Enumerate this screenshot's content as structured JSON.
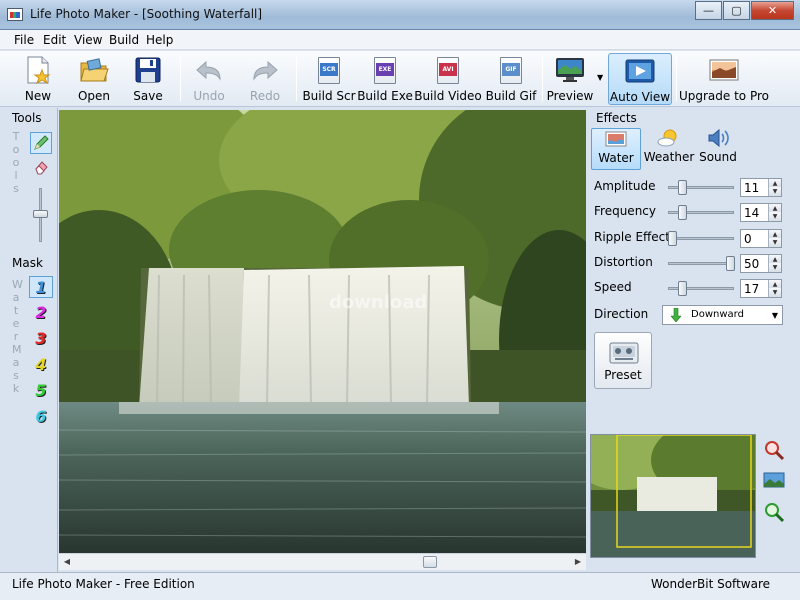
{
  "window": {
    "title": "Life Photo Maker - [Soothing Waterfall]",
    "minimize": "—",
    "maximize": "▢",
    "close": "✕"
  },
  "menu": [
    "File",
    "Edit",
    "View",
    "Build",
    "Help"
  ],
  "toolbar": {
    "new": "New",
    "open": "Open",
    "save": "Save",
    "undo": "Undo",
    "redo": "Redo",
    "build_scr": "Build Scr",
    "build_exe": "Build Exe",
    "build_video": "Build Video",
    "build_gif": "Build Gif",
    "preview": "Preview",
    "auto_view": "Auto View",
    "upgrade": "Upgrade to Pro",
    "scr_tag": "SCR",
    "exe_tag": "EXE",
    "avi_tag": "AVI",
    "gif_tag": "GIF"
  },
  "left": {
    "tools_title": "Tools",
    "tools_vertical": "Tools",
    "mask_title": "Mask",
    "mask_vertical": "Water Mask",
    "masks": [
      {
        "label": "1",
        "color": "#3f8ed8"
      },
      {
        "label": "2",
        "color": "#d92be0"
      },
      {
        "label": "3",
        "color": "#e02828"
      },
      {
        "label": "4",
        "color": "#e3d52a"
      },
      {
        "label": "5",
        "color": "#39c93a"
      },
      {
        "label": "6",
        "color": "#3fc7e2"
      }
    ]
  },
  "canvas": {
    "watermark": "download"
  },
  "effects": {
    "title": "Effects",
    "tabs": {
      "water": "Water",
      "weather": "Weather",
      "sound": "Sound"
    },
    "rows": [
      {
        "label": "Amplitude",
        "value": "11",
        "level": 0.18
      },
      {
        "label": "Frequency",
        "value": "14",
        "level": 0.18
      },
      {
        "label": "Ripple Effect",
        "value": "0",
        "level": 0.0
      },
      {
        "label": "Distortion",
        "value": "50",
        "level": 1.0
      },
      {
        "label": "Speed",
        "value": "17",
        "level": 0.18
      }
    ],
    "direction_label": "Direction",
    "direction_value": "Downward",
    "preset": "Preset"
  },
  "status": {
    "left": "Life Photo Maker - Free Edition",
    "right": "WonderBit Software"
  }
}
